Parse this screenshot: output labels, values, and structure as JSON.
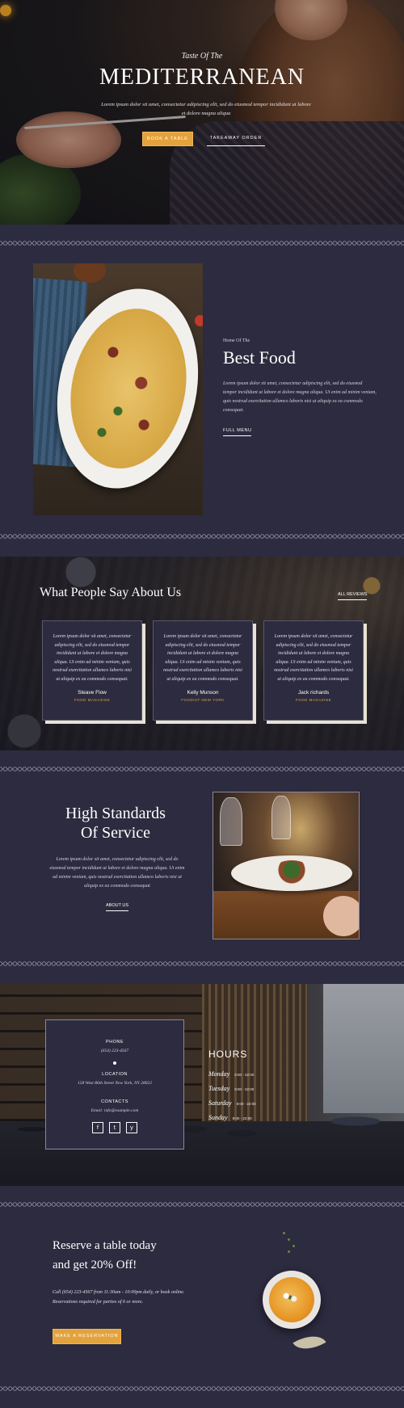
{
  "hero": {
    "subtitle": "Taste Of The",
    "title": "MEDITERRANEAN",
    "text": "Lorem ipsum dolor sit amet, consectetur adipiscing elit, sed do eiusmod tempor incididunt ut labore et dolore magna aliqua",
    "book_button": "BOOK A TABLE",
    "takeaway_button": "TAKEAWAY ORDER"
  },
  "best_food": {
    "small": "Home Of The",
    "title": "Best Food",
    "text": "Lorem ipsum dolor sit amet, consectetur adipiscing elit, sed do eiusmod tempor incididunt ut labore et dolore magna aliqua. Ut enim ad minim veniam, quis nostrud exercitation ullamco laboris nisi ut aliquip ex ea commodo consequat.",
    "link": "FULL MENU"
  },
  "testimonials": {
    "title": "What People Say About Us",
    "link": "ALL REVIEWS",
    "cards": [
      {
        "text": "Lorem ipsum dolor sit amet, consectetur adipiscing elit, sed do eiusmod tempor incididunt ut labore et dolore magna aliqua. Ut enim ad minim veniam, quis nostrud exercitation ullamco laboris nisi ut aliquip ex ea commodo consequat.",
        "name": "Steave Flow",
        "source": "FOOD MAGAZINE"
      },
      {
        "text": "Lorem ipsum dolor sit amet, consectetur adipiscing elit, sed do eiusmod tempor incididunt ut labore et dolore magna aliqua. Ut enim ad minim veniam, quis nostrud exercitation ullamco laboris nisi ut aliquip ex ea commodo consequat.",
        "name": "Kelly Munson",
        "source": "FOODIST NEW YORK"
      },
      {
        "text": "Lorem ipsum dolor sit amet, consectetur adipiscing elit, sed do eiusmod tempor incididunt ut labore et dolore magna aliqua. Ut enim ad minim veniam, quis nostrud exercitation ullamco laboris nisi ut aliquip ex ea commodo consequat.",
        "name": "Jack richards",
        "source": "FOOD MAGAZINE"
      }
    ]
  },
  "standards": {
    "title_line1": "High Standards",
    "title_line2": "Of Service",
    "text": "Lorem ipsum dolor sit amet, consectetur adipiscing elit, sed do eiusmod tempor incididunt ut labore et dolore magna aliqua. Ut enim ad minim veniam, quis nostrud exercitation ullamco laboris nisi ut aliquip ex ea commodo consequat",
    "link": "ABOUT US"
  },
  "contact": {
    "phone_label": "PHONE",
    "phone": "(654) 223-4567",
    "location_label": "LOCATION",
    "location": "158 West 86th Street New York, NY 28022",
    "contacts_label": "CONTACTS",
    "email": "Email: info@example.com",
    "social": [
      "facebook-icon",
      "twitter-icon",
      "yelp-icon"
    ]
  },
  "hours": {
    "title": "HOURS",
    "rows": [
      {
        "day": "Monday",
        "time": "9:00 - 22:00"
      },
      {
        "day": "Tuesday",
        "time": "9:00 - 22:00"
      },
      {
        "day": "Saturday",
        "time": "9:00 - 22:00"
      },
      {
        "day": "Sunday",
        "time": "9:00 - 22:00"
      }
    ]
  },
  "reserve": {
    "title_line1": "Reserve a table today",
    "title_line2": "and get 20% Off!",
    "text": "Call (654) 223-4567 from 11:30am - 10:00pm daily, or book online. Reservations required for parties of 6 or more.",
    "button": "MAKE A RESERVATION"
  },
  "colors": {
    "accent": "#e3a23b",
    "background": "#2c2b3f"
  }
}
